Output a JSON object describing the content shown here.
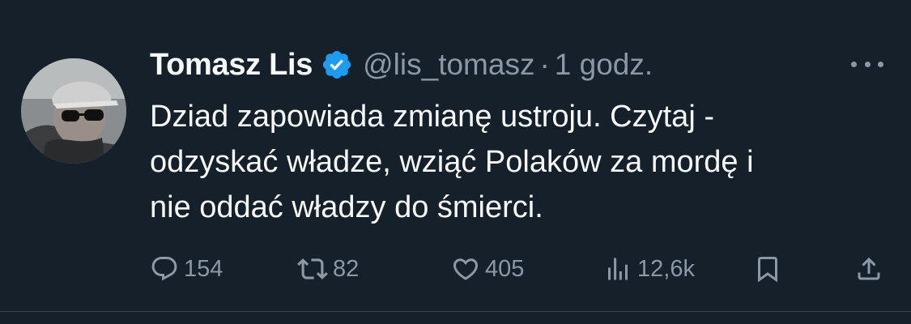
{
  "tweet": {
    "author": {
      "name": "Tomasz Lis",
      "handle": "@lis_tomasz",
      "verified": true,
      "avatar_icon": "profile-photo-man-sunglasses-cap"
    },
    "separator": "·",
    "time": "1 godz.",
    "text_lines": [
      "Dziad zapowiada zmianę ustroju. Czytaj -",
      "odzyskać władze, wziąć Polaków za mordę i",
      "nie oddać władzy do śmierci."
    ],
    "actions": {
      "reply": {
        "icon": "reply-icon",
        "count": "154"
      },
      "retweet": {
        "icon": "retweet-icon",
        "count": "82"
      },
      "like": {
        "icon": "heart-icon",
        "count": "405"
      },
      "views": {
        "icon": "views-icon",
        "count": "12,6k"
      },
      "bookmark": {
        "icon": "bookmark-icon"
      },
      "share": {
        "icon": "share-icon"
      }
    }
  },
  "colors": {
    "background": "#15202b",
    "text_primary": "#f7f9f9",
    "text_secondary": "#8b98a5",
    "verified_badge": "#1d9bf0",
    "divider": "#38444d"
  }
}
